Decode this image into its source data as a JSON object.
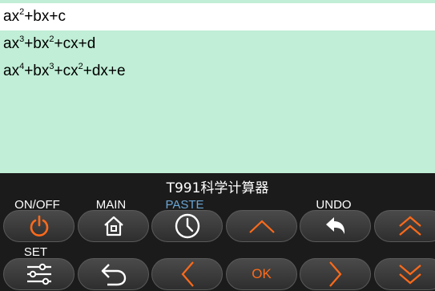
{
  "equations": [
    {
      "parts": [
        [
          "ax",
          ""
        ],
        [
          "2",
          "sup"
        ],
        [
          "+bx+c",
          ""
        ]
      ],
      "selected": true
    },
    {
      "parts": [
        [
          "ax",
          ""
        ],
        [
          "3",
          "sup"
        ],
        [
          "+bx",
          ""
        ],
        [
          "2",
          "sup"
        ],
        [
          "+cx+d",
          ""
        ]
      ],
      "selected": false
    },
    {
      "parts": [
        [
          "ax",
          ""
        ],
        [
          "4",
          "sup"
        ],
        [
          "+bx",
          ""
        ],
        [
          "3",
          "sup"
        ],
        [
          "+cx",
          ""
        ],
        [
          "2",
          "sup"
        ],
        [
          "+dx+e",
          ""
        ]
      ],
      "selected": false
    }
  ],
  "panel": {
    "title": "T991科学计算器",
    "labels": {
      "on_off": "ON/OFF",
      "main": "MAIN",
      "paste": "PASTE",
      "undo": "UNDO",
      "set": "SET"
    },
    "ok_label": "OK",
    "keys_row1": [
      "power-icon",
      "home-icon",
      "clock-icon",
      "up-arrow-icon",
      "undo-arrow-icon",
      "double-up-icon"
    ],
    "keys_row2": [
      "settings-sliders-icon",
      "back-icon",
      "left-arrow-icon",
      "ok",
      "right-arrow-icon",
      "double-down-icon"
    ],
    "accent_color": "#ff6a1a",
    "label_blue": "#6aa6d6"
  }
}
